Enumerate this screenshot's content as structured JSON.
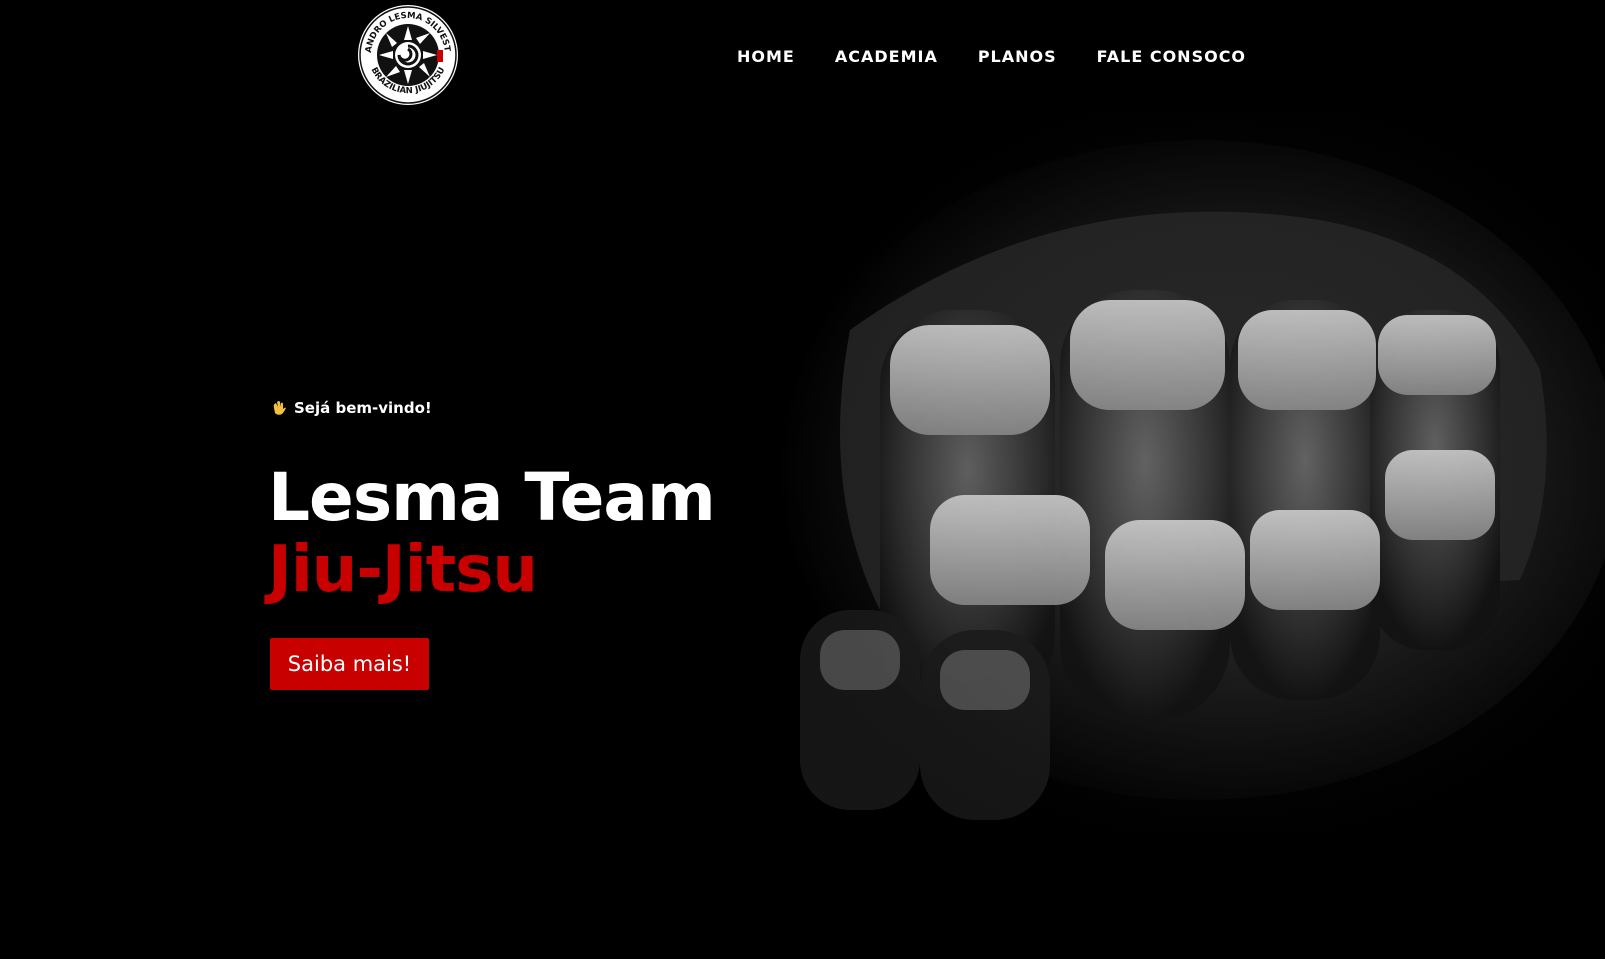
{
  "logo": {
    "top_text": "LEANDRO LESMA SILVESTRE",
    "bottom_text": "BRAZILIAN JIUJITSU"
  },
  "nav": {
    "items": [
      {
        "label": "HOME"
      },
      {
        "label": "ACADEMIA"
      },
      {
        "label": "PLANOS"
      },
      {
        "label": "FALE CONSOCO"
      }
    ]
  },
  "hero": {
    "greeting": "Sejá bem-vindo!",
    "title_line1": "Lesma Team",
    "title_line2": "Jiu-Jitsu",
    "cta_label": "Saiba mais!",
    "image_subject": "wrapped-fist-photo"
  },
  "colors": {
    "background": "#000000",
    "accent_red": "#c90000",
    "text": "#ffffff"
  }
}
